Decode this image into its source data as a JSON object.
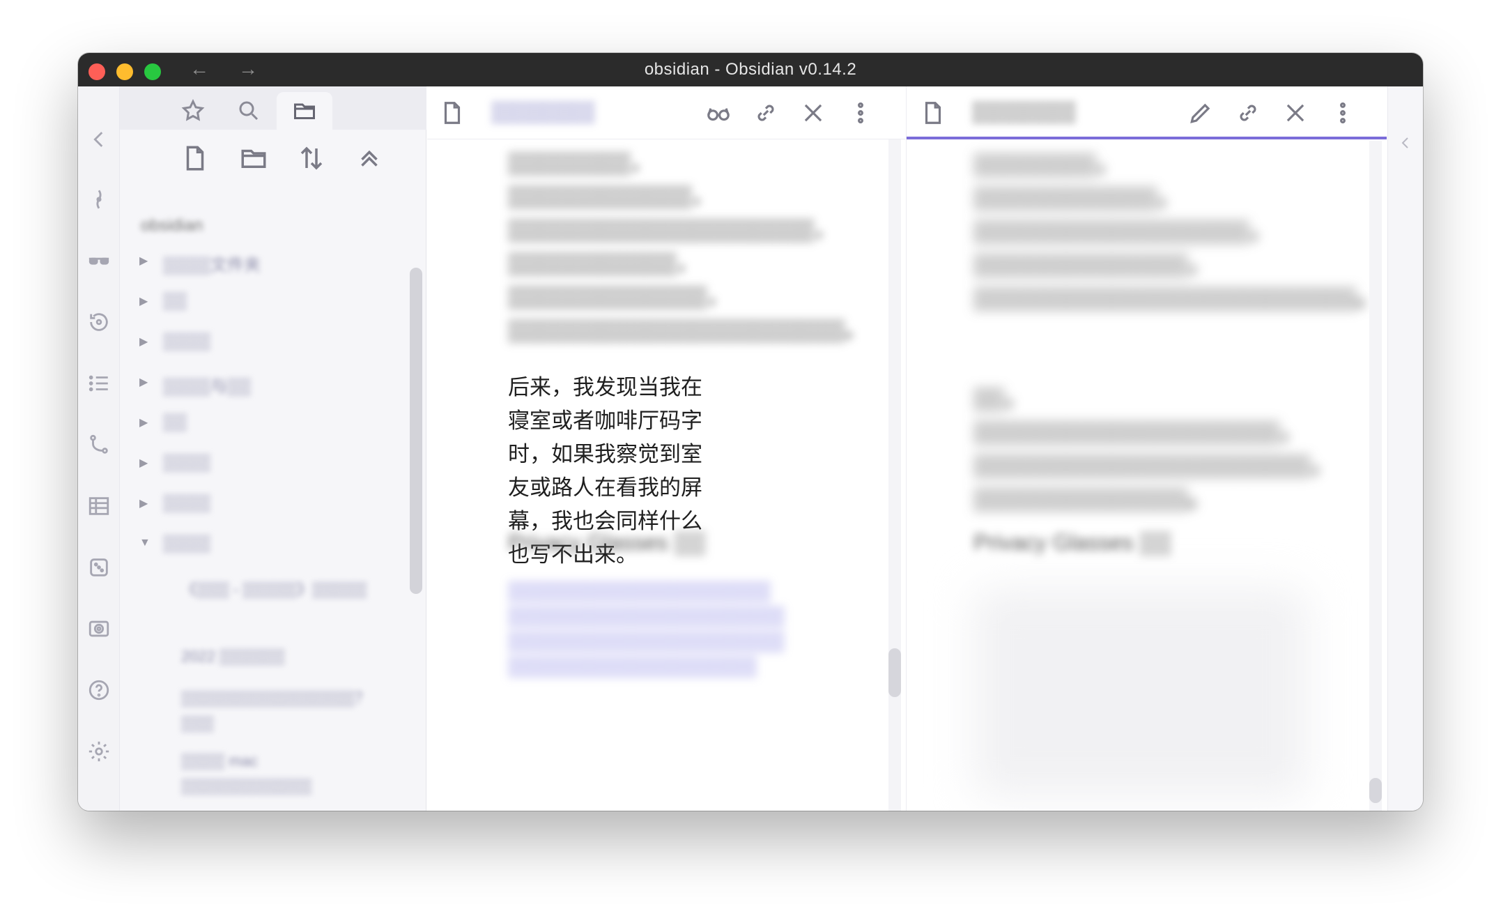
{
  "window": {
    "title": "obsidian - Obsidian v0.14.2",
    "back_arrow": "←",
    "forward_arrow": "→"
  },
  "ribbon": {
    "icons": [
      "collapse-left-icon",
      "graph-icon",
      "glasses-icon",
      "history-icon",
      "outline-icon",
      "branch-icon",
      "table-icon",
      "dice-icon",
      "screenshot-icon",
      "help-icon",
      "settings-icon"
    ]
  },
  "sidebar": {
    "tabs": [
      "starred-tab",
      "search-tab",
      "file-explorer-tab"
    ],
    "actions": [
      "new-note",
      "new-folder",
      "sort",
      "collapse-all"
    ],
    "vault_name": "obsidian",
    "folders": [
      {
        "label": "▒▒▒▒文件夹",
        "expanded": false
      },
      {
        "label": "▒▒",
        "expanded": false
      },
      {
        "label": "▒▒▒▒",
        "expanded": false
      },
      {
        "label": "▒▒▒▒与▒▒",
        "expanded": false
      },
      {
        "label": "▒▒",
        "expanded": false
      },
      {
        "label": "▒▒▒▒",
        "expanded": false
      },
      {
        "label": "▒▒▒▒",
        "expanded": false
      },
      {
        "label": "▒▒▒▒",
        "expanded": true
      }
    ],
    "files": [
      "《▒▒▒ - ▒▒▒▒▒》▒▒▒▒▒",
      "2022 ▒▒▒▒▒▒",
      "▒▒▒▒▒▒▒▒▒▒▒▒▒▒▒▒？▒▒▒",
      "▒▒▒▒ mac ▒▒▒▒▒▒▒▒▒▒▒▒"
    ]
  },
  "left_pane": {
    "title": "▒▒▒▒▒▒▒",
    "blurred_top": "▒▒▒▒▒▒▒▒，▒▒▒▒▒▒▒▒▒▒▒▒，▒▒▒▒▒▒▒▒▒▒▒▒▒▒▒▒▒▒▒▒，▒▒▒▒▒▒▒▒▒▒▒，▒▒▒▒▒▒▒▒▒▒▒▒▒，▒▒▒▒▒▒▒▒▒▒▒▒▒▒▒▒▒▒▒▒▒▒。",
    "paragraph": "后来，我发现当我在寝室或者咖啡厅码字时，如果我察觉到室友或路人在看我的屏幕，我也会同样什么也写不出来。",
    "heading_blur": "Privacy Glasses ▒▒",
    "link_blur": "▒▒▒▒▒▒▒▒▒▒▒▒▒▒▒▒▒▒▒ ▒▒▒▒▒▒▒▒▒▒▒▒▒▒▒▒▒▒▒▒ ▒▒▒▒▒▒▒▒▒▒▒▒▒▒▒▒▒▒▒▒ ▒▒▒▒▒▒▒▒▒▒▒▒▒▒▒▒▒▒"
  },
  "right_pane": {
    "title": "▒▒▒▒▒▒▒",
    "blurred_top": "▒▒▒▒▒▒▒▒，▒▒▒▒▒▒▒▒▒▒▒▒，▒▒▒▒▒▒▒▒▒▒▒▒▒▒▒▒▒▒，▒▒▒▒▒▒▒▒▒▒▒▒▒▒，▒▒▒▒▒▒▒▒▒▒▒▒▒▒▒▒▒▒▒▒▒▒▒▒▒。",
    "blurred_mid": "▒▒，▒▒▒▒▒▒▒▒▒▒▒▒▒▒▒▒▒▒▒▒，▒▒▒▒▒▒▒▒▒▒▒▒▒▒▒▒▒▒▒▒▒▒，▒▒▒▒▒▒▒▒▒▒▒▒▒▒。",
    "heading_blur": "Privacy Glasses ▒▒"
  },
  "colors": {
    "titlebar": "#2b2b2b",
    "accent": "#7b6cd9",
    "close": "#fe5f57",
    "minimize": "#febc2e",
    "maximize": "#28c840"
  }
}
